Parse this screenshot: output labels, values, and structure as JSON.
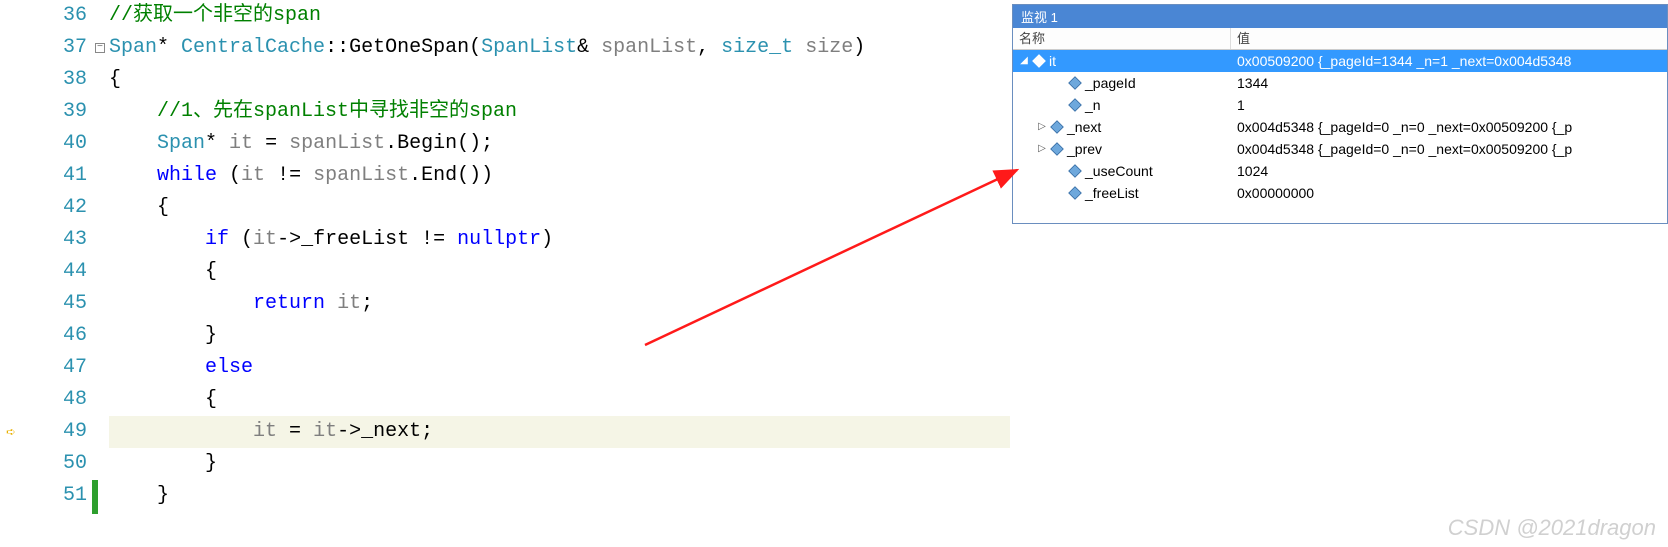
{
  "editor": {
    "lines": [
      {
        "num": 36,
        "html": "<span class='c-comment'>//获取一个非空的span</span>"
      },
      {
        "num": 37,
        "html": "<span class='c-type'>Span</span>* <span class='c-class'>CentralCache</span>::GetOneSpan(<span class='c-type'>SpanList</span>& <span class='c-var'>spanList</span>, <span class='c-type'>size_t</span> <span class='c-var'>size</span>)",
        "collapse": true
      },
      {
        "num": 38,
        "html": "{"
      },
      {
        "num": 39,
        "html": "    <span class='c-comment'>//1、先在spanList中寻找非空的span</span>"
      },
      {
        "num": 40,
        "html": "    <span class='c-type'>Span</span>* <span class='c-var'>it</span> = <span class='c-var'>spanList</span>.Begin();"
      },
      {
        "num": 41,
        "html": "    <span class='c-kw'>while</span> (<span class='c-var'>it</span> != <span class='c-var'>spanList</span>.End())"
      },
      {
        "num": 42,
        "html": "    {"
      },
      {
        "num": 43,
        "html": "        <span class='c-kw'>if</span> (<span class='c-var'>it</span>-&gt;_freeList != <span class='c-null'>nullptr</span>)"
      },
      {
        "num": 44,
        "html": "        {"
      },
      {
        "num": 45,
        "html": "            <span class='c-kw'>return</span> <span class='c-var'>it</span>;"
      },
      {
        "num": 46,
        "html": "        }"
      },
      {
        "num": 47,
        "html": "        <span class='c-kw'>else</span>"
      },
      {
        "num": 48,
        "html": "        {"
      },
      {
        "num": 49,
        "html": "            <span class='c-var'>it</span> = <span class='c-var'>it</span>-&gt;_next;",
        "current": true
      },
      {
        "num": 50,
        "html": "        }"
      },
      {
        "num": 51,
        "html": "    }"
      }
    ]
  },
  "watch": {
    "title": "监视 1",
    "headers": {
      "name": "名称",
      "value": "值"
    },
    "rows": [
      {
        "indent": 0,
        "expander": "▢",
        "icon": "white",
        "name": "it",
        "value": "0x00509200 {_pageId=1344 _n=1 _next=0x004d5348",
        "selected": true
      },
      {
        "indent": 2,
        "expander": "",
        "icon": "blue",
        "name": "_pageId",
        "value": "1344"
      },
      {
        "indent": 2,
        "expander": "",
        "icon": "blue",
        "name": "_n",
        "value": "1"
      },
      {
        "indent": 1,
        "expander": "▷",
        "icon": "blue",
        "name": "_next",
        "value": "0x004d5348 {_pageId=0 _n=0 _next=0x00509200 {_p"
      },
      {
        "indent": 1,
        "expander": "▷",
        "icon": "blue",
        "name": "_prev",
        "value": "0x004d5348 {_pageId=0 _n=0 _next=0x00509200 {_p"
      },
      {
        "indent": 2,
        "expander": "",
        "icon": "blue",
        "name": "_useCount",
        "value": "1024",
        "pointed": true
      },
      {
        "indent": 2,
        "expander": "",
        "icon": "blue",
        "name": "_freeList",
        "value": "0x00000000"
      }
    ]
  },
  "watermark": "CSDN @2021dragon"
}
